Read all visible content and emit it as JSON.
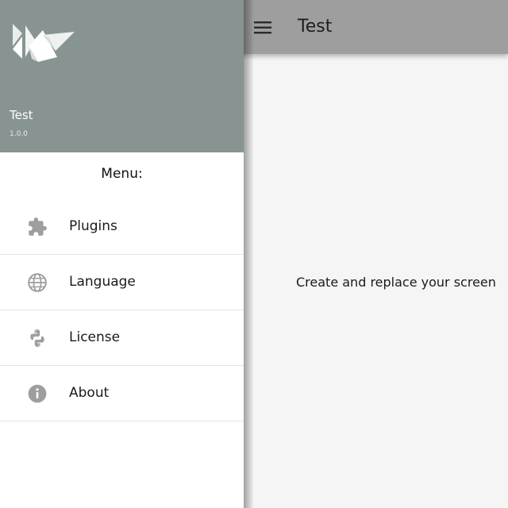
{
  "toolbar": {
    "title": "Test",
    "menu_icon": "hamburger-menu-icon"
  },
  "content": {
    "text": "Create and replace your screen"
  },
  "drawer": {
    "header": {
      "logo": "kivy-logo",
      "app_name": "Test",
      "version": "1.0.0",
      "background": "#879492"
    },
    "menu_title": "Menu:",
    "items": [
      {
        "label": "Plugins",
        "icon": "puzzle-icon"
      },
      {
        "label": "Language",
        "icon": "globe-icon"
      },
      {
        "label": "License",
        "icon": "python-icon"
      },
      {
        "label": "About",
        "icon": "info-icon"
      }
    ]
  },
  "colors": {
    "toolbar": "#9e9e9e",
    "content_background": "#f5f5f5",
    "drawer_background": "#ffffff",
    "icon_gray": "#9e9e9e"
  }
}
